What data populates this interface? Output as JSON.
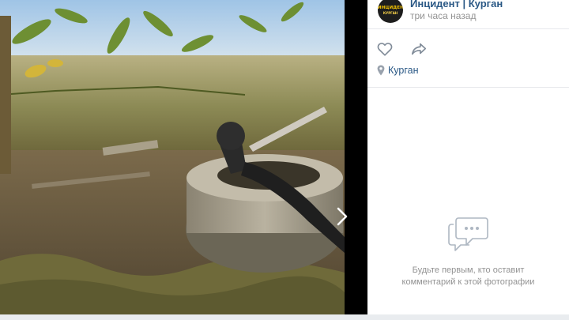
{
  "post": {
    "group_name": "Инцидент | Курган",
    "time": "три часа назад",
    "avatar": {
      "line1": "ИНЦИДЕНТ",
      "line2": "КУРГАН"
    },
    "location": "Курган"
  },
  "icons": {
    "like": "heart-icon",
    "share": "share-icon",
    "location": "location-pin-icon",
    "next": "chevron-right-icon",
    "comments": "comment-bubble-icon"
  },
  "comments": {
    "empty_line1": "Будьте первым, кто оставит",
    "empty_line2": "комментарий к этой фотографии"
  },
  "colors": {
    "link": "#2a5885",
    "muted": "#939393",
    "divider": "#e7e8ec",
    "icon": "#818c99",
    "empty_icon": "#aeb7c2"
  }
}
